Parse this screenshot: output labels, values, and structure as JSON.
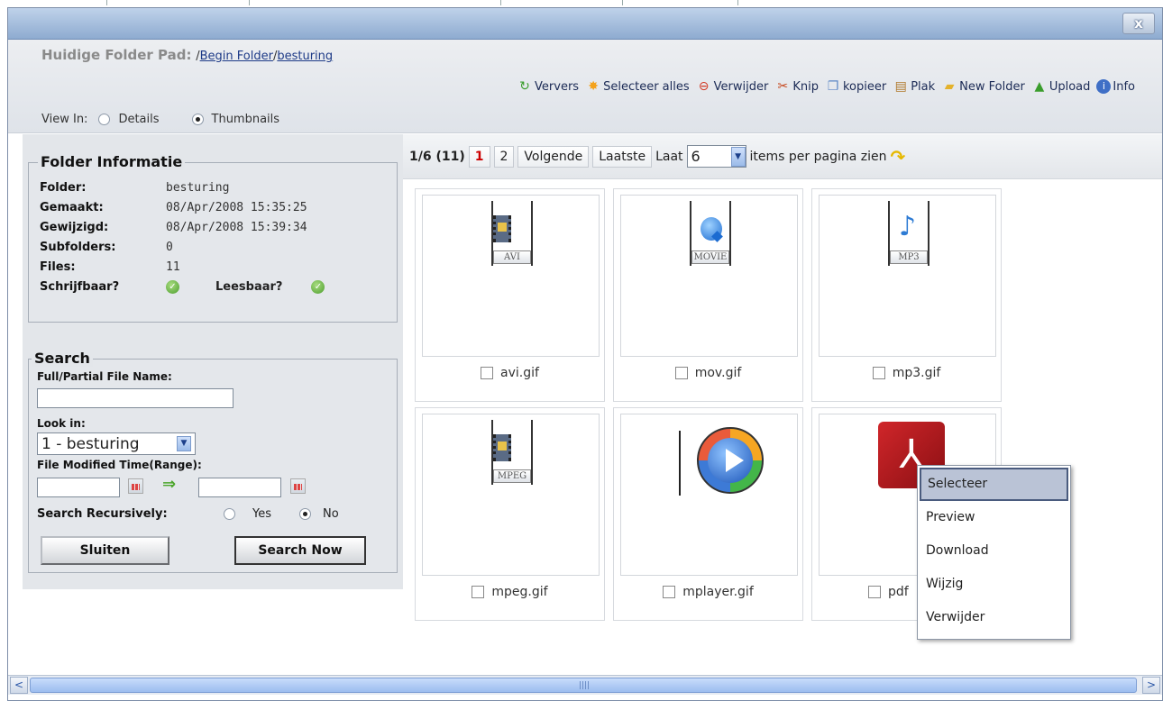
{
  "window": {
    "close_label": "x"
  },
  "path": {
    "label": "Huidige Folder Pad:",
    "sep1": "/",
    "crumb_root": "Begin Folder",
    "sep2": "/",
    "crumb_current": "besturing"
  },
  "toolbar": [
    {
      "label": "Ververs",
      "icon": "refresh-icon"
    },
    {
      "label": "Selecteer alles",
      "icon": "select-all-icon"
    },
    {
      "label": "Verwijder",
      "icon": "delete-icon"
    },
    {
      "label": "Knip",
      "icon": "cut-icon"
    },
    {
      "label": "kopieer",
      "icon": "copy-icon"
    },
    {
      "label": "Plak",
      "icon": "paste-icon"
    },
    {
      "label": "New Folder",
      "icon": "new-folder-icon"
    },
    {
      "label": "Upload",
      "icon": "upload-icon"
    },
    {
      "label": "Info",
      "icon": "info-icon"
    }
  ],
  "view": {
    "label": "View In:",
    "details": "Details",
    "thumbnails": "Thumbnails",
    "selected": "thumbnails"
  },
  "folder_info": {
    "title": "Folder Informatie",
    "rows": [
      {
        "key": "Folder:",
        "value": "besturing"
      },
      {
        "key": "Gemaakt:",
        "value": "08/Apr/2008 15:35:25"
      },
      {
        "key": "Gewijzigd:",
        "value": "08/Apr/2008 15:39:34"
      },
      {
        "key": "Subfolders:",
        "value": "0"
      },
      {
        "key": "Files:",
        "value": "11"
      }
    ],
    "writable_label": "Schrijfbaar?",
    "readable_label": "Leesbaar?"
  },
  "search": {
    "title": "Search",
    "name_label": "Full/Partial File Name:",
    "name_value": "",
    "look_in_label": "Look in:",
    "look_in_value": "1 - besturing",
    "modified_label": "File Modified Time(Range):",
    "recursive_label": "Search Recursively:",
    "yes": "Yes",
    "no": "No",
    "recursive_selected": "no",
    "close_button": "Sluiten",
    "search_button": "Search Now"
  },
  "pager": {
    "summary": "1/6 (11)",
    "page1": "1",
    "page2": "2",
    "next": "Volgende",
    "last": "Laatste",
    "show_label": "Laat",
    "per_page": "6",
    "suffix": "items per pagina zien"
  },
  "files": [
    {
      "name": "avi.gif",
      "tag": "AVI",
      "kind": "video"
    },
    {
      "name": "mov.gif",
      "tag": "MOVIE",
      "kind": "quicktime"
    },
    {
      "name": "mp3.gif",
      "tag": "MP3",
      "kind": "audio"
    },
    {
      "name": "mpeg.gif",
      "tag": "MPEG",
      "kind": "video"
    },
    {
      "name": "mplayer.gif",
      "tag": "",
      "kind": "media-player"
    },
    {
      "name": "pdf",
      "tag": "",
      "kind": "pdf"
    }
  ],
  "context_menu": {
    "items": [
      "Selecteer",
      "Preview",
      "Download",
      "Wijzig",
      "Verwijder"
    ],
    "active": "Selecteer"
  },
  "scrollbar": {
    "left": "<",
    "right": ">"
  }
}
